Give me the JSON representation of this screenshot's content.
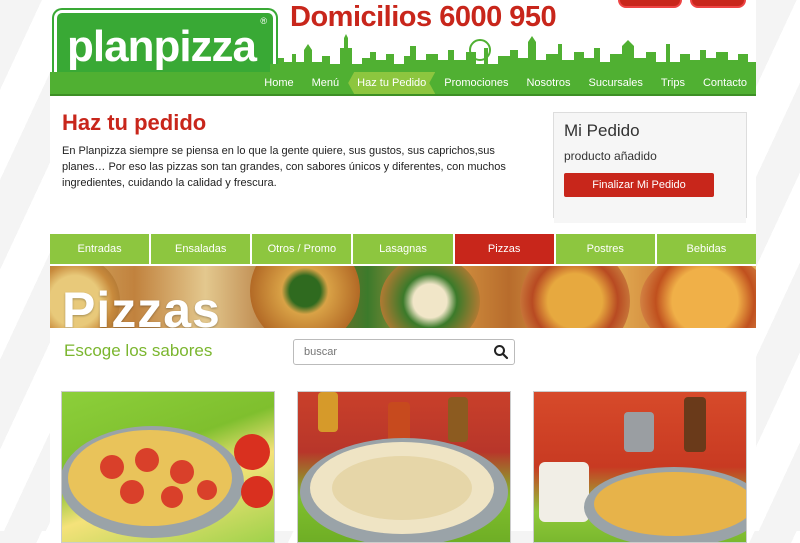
{
  "header": {
    "logo_text": "planpizza",
    "logo_reg": "®",
    "phone": "Domicilios 6000 950"
  },
  "nav": {
    "items": [
      {
        "label": "Home"
      },
      {
        "label": "Menú"
      },
      {
        "label": "Haz tu Pedido",
        "active": true
      },
      {
        "label": "Promociones"
      },
      {
        "label": "Nosotros"
      },
      {
        "label": "Sucursales"
      },
      {
        "label": "Trips"
      },
      {
        "label": "Contacto"
      }
    ]
  },
  "intro": {
    "title": "Haz tu pedido",
    "text": "En Planpizza siempre se piensa en lo que la gente quiere, sus gustos, sus caprichos,sus planes… Por eso las pizzas son tan grandes, con sabores únicos y diferentes, con muchos ingredientes, cuidando la calidad y frescura."
  },
  "order": {
    "title": "Mi Pedido",
    "subtitle": "producto añadido",
    "button": "Finalizar Mi Pedido"
  },
  "categories": [
    {
      "label": "Entradas"
    },
    {
      "label": "Ensaladas"
    },
    {
      "label": "Otros / Promo"
    },
    {
      "label": "Lasagnas"
    },
    {
      "label": "Pizzas",
      "active": true
    },
    {
      "label": "Postres"
    },
    {
      "label": "Bebidas"
    }
  ],
  "banner": {
    "title": "Pizzas"
  },
  "filter": {
    "heading": "Escoge los sabores",
    "search_placeholder": "buscar"
  },
  "colors": {
    "brand_green": "#39a935",
    "nav_green": "#50b032",
    "light_green": "#8dc63f",
    "accent_red": "#c8261b"
  }
}
